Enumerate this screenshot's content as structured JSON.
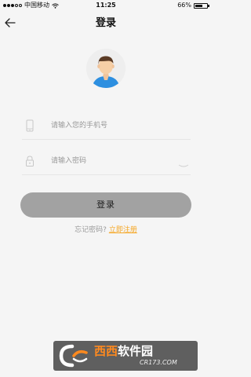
{
  "status_bar": {
    "carrier": "中国移动",
    "time": "11:25",
    "battery": "66%",
    "battery_level": 0.66
  },
  "nav": {
    "title": "登录",
    "back_icon": "arrow-left-icon"
  },
  "avatar": {
    "icon": "user-avatar-icon"
  },
  "phone_field": {
    "placeholder": "请输入您的手机号",
    "value": "",
    "icon": "phone-icon"
  },
  "password_field": {
    "placeholder": "请输入密码",
    "value": "",
    "icon": "lock-icon",
    "toggle_icon": "eye-closed-icon"
  },
  "login_button": {
    "label": "登录"
  },
  "footer": {
    "forgot_label": "忘记密码?",
    "register_label": "立即注册"
  },
  "watermark": {
    "brand_part1": "西西",
    "brand_part2": "软件园",
    "site": "CR173.COM"
  },
  "colors": {
    "background": "#f5f5f5",
    "button_bg": "#a2a2a2",
    "link_accent": "#f5a623",
    "watermark_orange": "#ff8a1f"
  }
}
